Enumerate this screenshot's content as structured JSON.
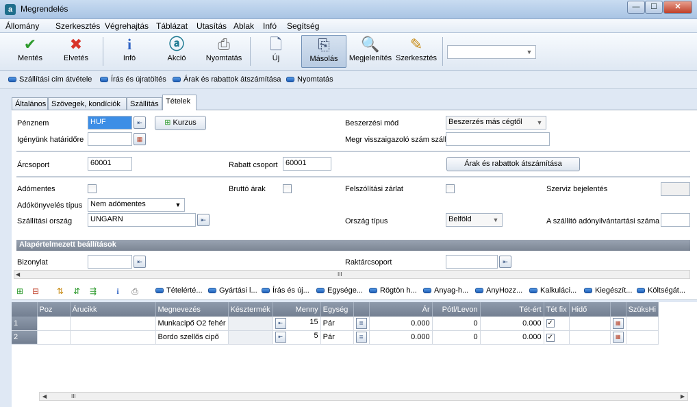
{
  "window": {
    "title": "Megrendelés",
    "app_icon": "a",
    "min_glyph": "—",
    "max_glyph": "☐",
    "close_glyph": "✕"
  },
  "menu": [
    "Állomány",
    "Szerkesztés",
    "Végrehajtás",
    "Táblázat",
    "Utasítás",
    "Ablak",
    "Infó",
    "Segítség"
  ],
  "toolbar": {
    "save": "Mentés",
    "discard": "Elvetés",
    "info": "Infó",
    "action": "Akció",
    "print": "Nyomtatás",
    "new": "Új",
    "copy": "Másolás",
    "display": "Megjelenítés",
    "edit": "Szerkesztés",
    "combo_value": ""
  },
  "actions": [
    "Szállítási cím átvétele",
    "Írás és újratöltés",
    "Árak és rabattok átszámítása",
    "Nyomtatás"
  ],
  "tabs": [
    "Általános",
    "Szövegek, kondíciók",
    "Szállítás",
    "Tételek"
  ],
  "form": {
    "currency_label": "Pénznem",
    "currency_value": "HUF",
    "rate_button": "Kurzus",
    "deadline_label": "Igényünk határidőre",
    "deadline_value": "",
    "procurement_label": "Beszerzési mód",
    "procurement_value": "Beszerzés más cégtől",
    "confirm_label": "Megr visszaigazoló szám szállító",
    "confirm_value": "",
    "pricegroup_label": "Árcsoport",
    "pricegroup_value": "60001",
    "discountgroup_label": "Rabatt csoport",
    "discountgroup_value": "60001",
    "recalc_button": "Árak és rabattok átszámítása",
    "taxfree_label": "Adómentes",
    "gross_label": "Bruttó árak",
    "dunning_label": "Felszólítási zárlat",
    "service_label": "Szerviz bejelentés",
    "taxbook_label": "Adókönyvelés típus",
    "taxbook_value": "Nem adómentes",
    "country_label": "Szállítási ország",
    "country_value": "UNGARN",
    "countrytype_label": "Ország típus",
    "countrytype_value": "Belföld",
    "vat_label": "A szállító adónyilvántartási száma",
    "vat_value": "",
    "section_title": "Alapértelmezett beállítások",
    "voucher_label": "Bizonylat",
    "voucher_value": "",
    "warehouse_label": "Raktárcsoport",
    "warehouse_value": ""
  },
  "grid_actions": [
    "Tételérté...",
    "Gyártási l...",
    "Írás és új...",
    "Egysége...",
    "Rögtön h...",
    "Anyag-h...",
    "AnyHozz...",
    "Kalkuláci...",
    "Kiegészít...",
    "Költségát..."
  ],
  "grid": {
    "columns": [
      "Poz",
      "Árucikk",
      "Megnevezés",
      "Késztermék",
      "",
      "Menny",
      "Egység",
      "",
      "Ár",
      "Pótl/Levon",
      "Tét-ért",
      "Tét fix",
      "Hidő",
      "",
      "SzüksHi"
    ],
    "rows": [
      {
        "no": "1",
        "pos": "",
        "item": "",
        "name": "Munkacipő O2 fehér",
        "product": "",
        "qty": "15",
        "unit": "Pár",
        "price": "0.000",
        "surcharge": "0",
        "value": "0.000",
        "fixed": "✓",
        "time": ""
      },
      {
        "no": "2",
        "pos": "",
        "item": "",
        "name": "Bordo szellős cipő",
        "product": "",
        "qty": "5",
        "unit": "Pár",
        "price": "0.000",
        "surcharge": "0",
        "value": "0.000",
        "fixed": "✓",
        "time": ""
      }
    ]
  },
  "scroll": {
    "grip": "III",
    "left": "◀",
    "right": "▶"
  }
}
